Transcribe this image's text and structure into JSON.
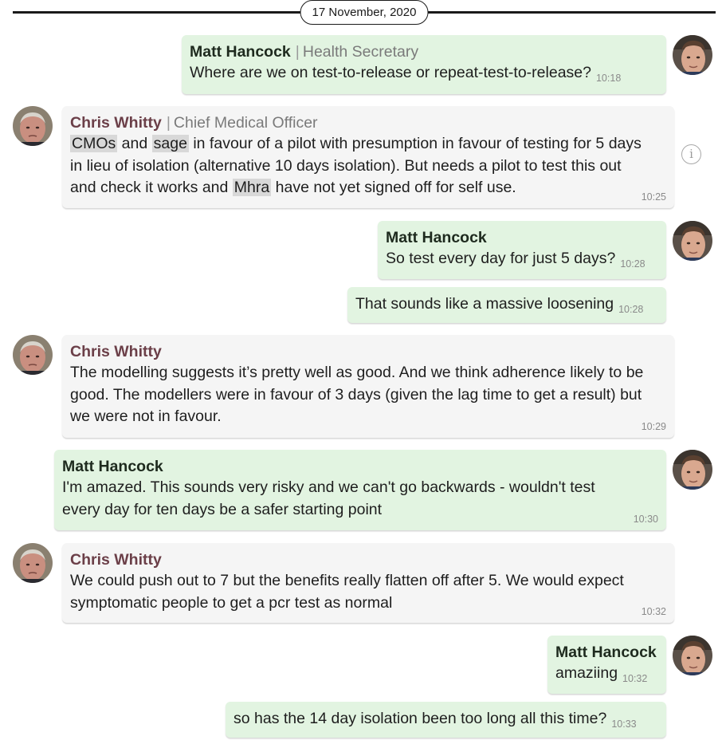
{
  "date_divider": "17 November, 2020",
  "participants": {
    "hancock": {
      "name": "Matt Hancock",
      "role": "Health Secretary",
      "avatar_icon": "avatar-matt-hancock"
    },
    "whitty": {
      "name": "Chris Whitty",
      "role": "Chief Medical Officer",
      "avatar_icon": "avatar-chris-whitty"
    }
  },
  "messages": [
    {
      "sender": "Matt Hancock",
      "role": "Health Secretary",
      "text": "Where are we on test-to-release or repeat-test-to-release?",
      "time": "10:18"
    },
    {
      "sender": "Chris Whitty",
      "role": "Chief Medical Officer",
      "segments": [
        {
          "t": "CMOs",
          "hl": true
        },
        {
          "t": " and "
        },
        {
          "t": "sage",
          "hl": true
        },
        {
          "t": " in favour of a pilot with presumption in favour of testing for 5 days in lieu of isolation (alternative 10 days isolation). But needs a pilot to test this out and check it works and "
        },
        {
          "t": "Mhra",
          "hl": true
        },
        {
          "t": " have not yet signed off for self use."
        }
      ],
      "time": "10:25"
    },
    {
      "sender": "Matt Hancock",
      "text": "So test every day for just 5 days?",
      "time": "10:28"
    },
    {
      "text": "That sounds like a massive loosening",
      "time": "10:28"
    },
    {
      "sender": "Chris Whitty",
      "text": "The modelling suggests it’s pretty well as good. And we think adherence likely to be good. The modellers were in favour of 3 days (given the lag time to get a result) but we were not in favour.",
      "time": "10:29"
    },
    {
      "sender": "Matt Hancock",
      "text": "I'm amazed. This sounds very risky and we can't go backwards - wouldn't test every day for ten days be a safer starting point",
      "time": "10:30"
    },
    {
      "sender": "Chris Whitty",
      "text": "We could push out to 7 but the benefits really flatten off after 5. We would expect symptomatic people to get a pcr test as normal",
      "time": "10:32"
    },
    {
      "sender": "Matt Hancock",
      "text": "amaziing",
      "time": "10:32"
    },
    {
      "text": "so has the 14 day isolation been too long all this time?",
      "time": "10:33"
    }
  ],
  "info_icon": "info-icon",
  "colors": {
    "outgoing_bubble": "#e2f4e1",
    "incoming_bubble": "#f5f5f5",
    "incoming_name": "#6b3f48"
  }
}
